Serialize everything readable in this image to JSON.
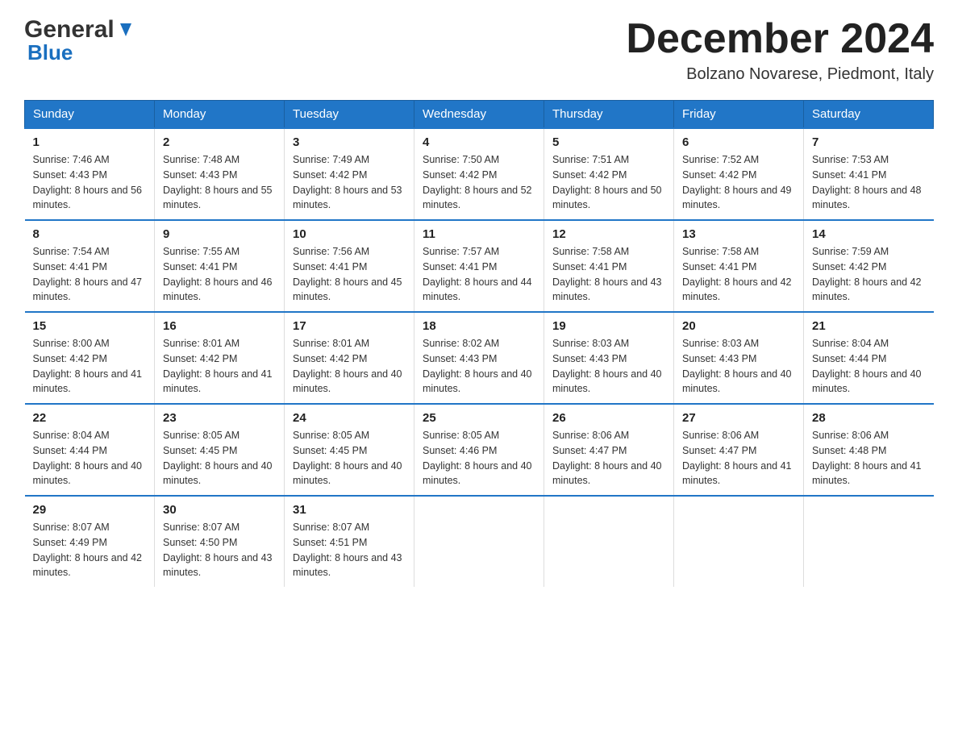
{
  "logo": {
    "line1": "General",
    "line2": "Blue",
    "tagline": "Blue"
  },
  "header": {
    "month_year": "December 2024",
    "location": "Bolzano Novarese, Piedmont, Italy"
  },
  "days_of_week": [
    "Sunday",
    "Monday",
    "Tuesday",
    "Wednesday",
    "Thursday",
    "Friday",
    "Saturday"
  ],
  "weeks": [
    [
      {
        "day": "1",
        "sunrise": "Sunrise: 7:46 AM",
        "sunset": "Sunset: 4:43 PM",
        "daylight": "Daylight: 8 hours and 56 minutes."
      },
      {
        "day": "2",
        "sunrise": "Sunrise: 7:48 AM",
        "sunset": "Sunset: 4:43 PM",
        "daylight": "Daylight: 8 hours and 55 minutes."
      },
      {
        "day": "3",
        "sunrise": "Sunrise: 7:49 AM",
        "sunset": "Sunset: 4:42 PM",
        "daylight": "Daylight: 8 hours and 53 minutes."
      },
      {
        "day": "4",
        "sunrise": "Sunrise: 7:50 AM",
        "sunset": "Sunset: 4:42 PM",
        "daylight": "Daylight: 8 hours and 52 minutes."
      },
      {
        "day": "5",
        "sunrise": "Sunrise: 7:51 AM",
        "sunset": "Sunset: 4:42 PM",
        "daylight": "Daylight: 8 hours and 50 minutes."
      },
      {
        "day": "6",
        "sunrise": "Sunrise: 7:52 AM",
        "sunset": "Sunset: 4:42 PM",
        "daylight": "Daylight: 8 hours and 49 minutes."
      },
      {
        "day": "7",
        "sunrise": "Sunrise: 7:53 AM",
        "sunset": "Sunset: 4:41 PM",
        "daylight": "Daylight: 8 hours and 48 minutes."
      }
    ],
    [
      {
        "day": "8",
        "sunrise": "Sunrise: 7:54 AM",
        "sunset": "Sunset: 4:41 PM",
        "daylight": "Daylight: 8 hours and 47 minutes."
      },
      {
        "day": "9",
        "sunrise": "Sunrise: 7:55 AM",
        "sunset": "Sunset: 4:41 PM",
        "daylight": "Daylight: 8 hours and 46 minutes."
      },
      {
        "day": "10",
        "sunrise": "Sunrise: 7:56 AM",
        "sunset": "Sunset: 4:41 PM",
        "daylight": "Daylight: 8 hours and 45 minutes."
      },
      {
        "day": "11",
        "sunrise": "Sunrise: 7:57 AM",
        "sunset": "Sunset: 4:41 PM",
        "daylight": "Daylight: 8 hours and 44 minutes."
      },
      {
        "day": "12",
        "sunrise": "Sunrise: 7:58 AM",
        "sunset": "Sunset: 4:41 PM",
        "daylight": "Daylight: 8 hours and 43 minutes."
      },
      {
        "day": "13",
        "sunrise": "Sunrise: 7:58 AM",
        "sunset": "Sunset: 4:41 PM",
        "daylight": "Daylight: 8 hours and 42 minutes."
      },
      {
        "day": "14",
        "sunrise": "Sunrise: 7:59 AM",
        "sunset": "Sunset: 4:42 PM",
        "daylight": "Daylight: 8 hours and 42 minutes."
      }
    ],
    [
      {
        "day": "15",
        "sunrise": "Sunrise: 8:00 AM",
        "sunset": "Sunset: 4:42 PM",
        "daylight": "Daylight: 8 hours and 41 minutes."
      },
      {
        "day": "16",
        "sunrise": "Sunrise: 8:01 AM",
        "sunset": "Sunset: 4:42 PM",
        "daylight": "Daylight: 8 hours and 41 minutes."
      },
      {
        "day": "17",
        "sunrise": "Sunrise: 8:01 AM",
        "sunset": "Sunset: 4:42 PM",
        "daylight": "Daylight: 8 hours and 40 minutes."
      },
      {
        "day": "18",
        "sunrise": "Sunrise: 8:02 AM",
        "sunset": "Sunset: 4:43 PM",
        "daylight": "Daylight: 8 hours and 40 minutes."
      },
      {
        "day": "19",
        "sunrise": "Sunrise: 8:03 AM",
        "sunset": "Sunset: 4:43 PM",
        "daylight": "Daylight: 8 hours and 40 minutes."
      },
      {
        "day": "20",
        "sunrise": "Sunrise: 8:03 AM",
        "sunset": "Sunset: 4:43 PM",
        "daylight": "Daylight: 8 hours and 40 minutes."
      },
      {
        "day": "21",
        "sunrise": "Sunrise: 8:04 AM",
        "sunset": "Sunset: 4:44 PM",
        "daylight": "Daylight: 8 hours and 40 minutes."
      }
    ],
    [
      {
        "day": "22",
        "sunrise": "Sunrise: 8:04 AM",
        "sunset": "Sunset: 4:44 PM",
        "daylight": "Daylight: 8 hours and 40 minutes."
      },
      {
        "day": "23",
        "sunrise": "Sunrise: 8:05 AM",
        "sunset": "Sunset: 4:45 PM",
        "daylight": "Daylight: 8 hours and 40 minutes."
      },
      {
        "day": "24",
        "sunrise": "Sunrise: 8:05 AM",
        "sunset": "Sunset: 4:45 PM",
        "daylight": "Daylight: 8 hours and 40 minutes."
      },
      {
        "day": "25",
        "sunrise": "Sunrise: 8:05 AM",
        "sunset": "Sunset: 4:46 PM",
        "daylight": "Daylight: 8 hours and 40 minutes."
      },
      {
        "day": "26",
        "sunrise": "Sunrise: 8:06 AM",
        "sunset": "Sunset: 4:47 PM",
        "daylight": "Daylight: 8 hours and 40 minutes."
      },
      {
        "day": "27",
        "sunrise": "Sunrise: 8:06 AM",
        "sunset": "Sunset: 4:47 PM",
        "daylight": "Daylight: 8 hours and 41 minutes."
      },
      {
        "day": "28",
        "sunrise": "Sunrise: 8:06 AM",
        "sunset": "Sunset: 4:48 PM",
        "daylight": "Daylight: 8 hours and 41 minutes."
      }
    ],
    [
      {
        "day": "29",
        "sunrise": "Sunrise: 8:07 AM",
        "sunset": "Sunset: 4:49 PM",
        "daylight": "Daylight: 8 hours and 42 minutes."
      },
      {
        "day": "30",
        "sunrise": "Sunrise: 8:07 AM",
        "sunset": "Sunset: 4:50 PM",
        "daylight": "Daylight: 8 hours and 43 minutes."
      },
      {
        "day": "31",
        "sunrise": "Sunrise: 8:07 AM",
        "sunset": "Sunset: 4:51 PM",
        "daylight": "Daylight: 8 hours and 43 minutes."
      },
      {
        "day": "",
        "sunrise": "",
        "sunset": "",
        "daylight": ""
      },
      {
        "day": "",
        "sunrise": "",
        "sunset": "",
        "daylight": ""
      },
      {
        "day": "",
        "sunrise": "",
        "sunset": "",
        "daylight": ""
      },
      {
        "day": "",
        "sunrise": "",
        "sunset": "",
        "daylight": ""
      }
    ]
  ]
}
